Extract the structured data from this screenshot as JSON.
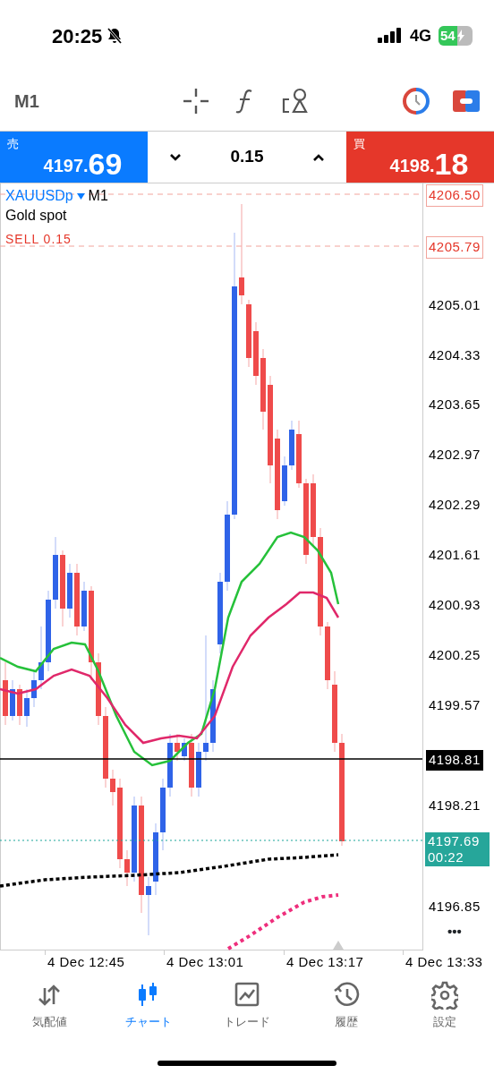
{
  "status_bar": {
    "time": "20:25",
    "network": "4G",
    "battery": "54"
  },
  "toolbar": {
    "timeframe": "M1"
  },
  "trade_bar": {
    "sell": {
      "label": "売",
      "price_main": "4197.",
      "price_big": "69"
    },
    "volume": "0.15",
    "buy": {
      "label": "買",
      "price_main": "4198.",
      "price_big": "18"
    }
  },
  "chart": {
    "symbol": "XAUUSDp",
    "timeframe": "M1",
    "description": "Gold spot",
    "position_label": "SELL 0.15",
    "price_ticks": [
      "4205.01",
      "4204.33",
      "4203.65",
      "4202.97",
      "4202.29",
      "4201.61",
      "4200.93",
      "4200.25",
      "4199.57",
      "4198.21",
      "4196.85"
    ],
    "order_lines": [
      {
        "label": "4206.50"
      },
      {
        "label": "4205.79"
      }
    ],
    "last_price": "4198.81",
    "bid": {
      "price": "4197.69",
      "countdown": "00:22"
    },
    "more": "•••",
    "time_ticks": [
      "4 Dec 12:45",
      "4 Dec 13:01",
      "4 Dec 13:17",
      "4 Dec 13:33"
    ]
  },
  "tabs": [
    {
      "label": "気配値",
      "selected": false
    },
    {
      "label": "チャート",
      "selected": true
    },
    {
      "label": "トレード",
      "selected": false
    },
    {
      "label": "履歴",
      "selected": false
    },
    {
      "label": "設定",
      "selected": false
    }
  ]
}
